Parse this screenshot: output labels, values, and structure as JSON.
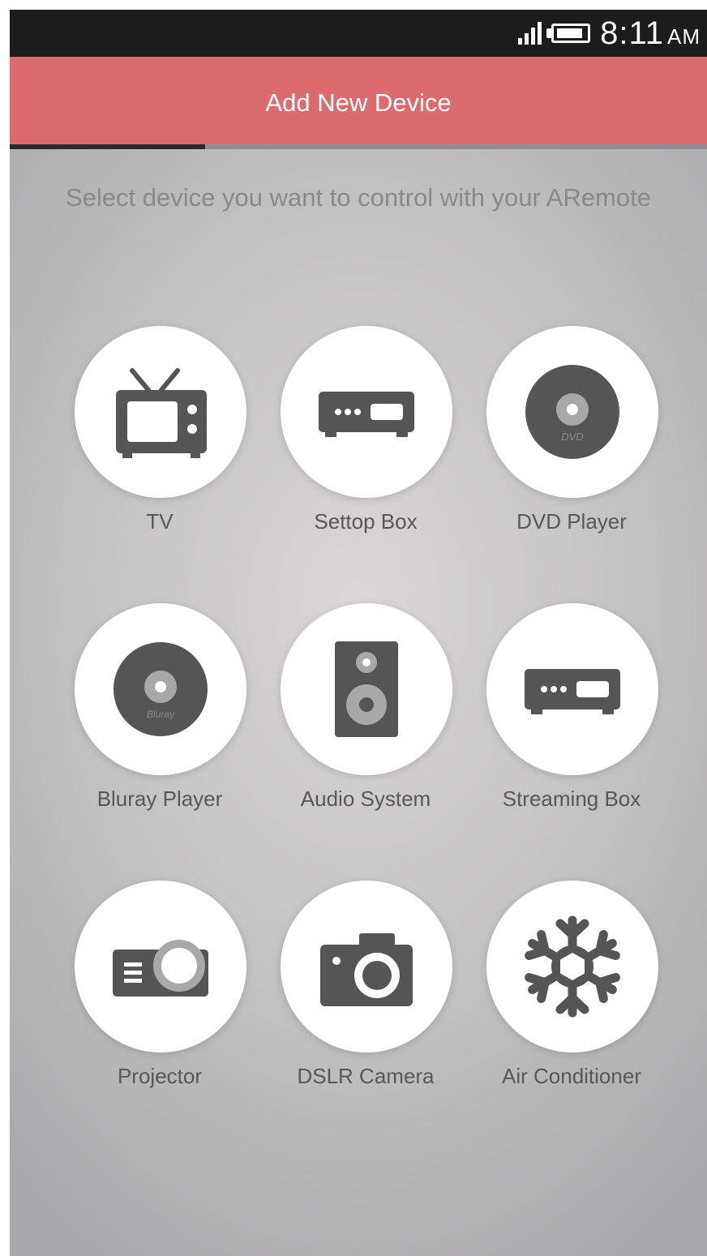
{
  "status_bar": {
    "time": "8:11",
    "ampm": "AM",
    "signal_bars": 4,
    "battery_level": 0.9
  },
  "header": {
    "title": "Add New Device",
    "wizard_progress": 0.28,
    "accent_color": "#dc6b6d"
  },
  "instruction": "Select device you want to control with your ARemote",
  "devices": [
    {
      "label": "TV",
      "icon": "tv-icon"
    },
    {
      "label": "Settop Box",
      "icon": "settop-box-icon"
    },
    {
      "label": "DVD Player",
      "icon": "dvd-disc-icon",
      "icon_text": "DVD"
    },
    {
      "label": "Bluray Player",
      "icon": "bluray-disc-icon",
      "icon_text": "Bluray"
    },
    {
      "label": "Audio System",
      "icon": "speaker-icon"
    },
    {
      "label": "Streaming Box",
      "icon": "streaming-box-icon"
    },
    {
      "label": "Projector",
      "icon": "projector-icon"
    },
    {
      "label": "DSLR Camera",
      "icon": "camera-icon"
    },
    {
      "label": "Air Conditioner",
      "icon": "snowflake-icon"
    }
  ],
  "icon_color": "#555555"
}
